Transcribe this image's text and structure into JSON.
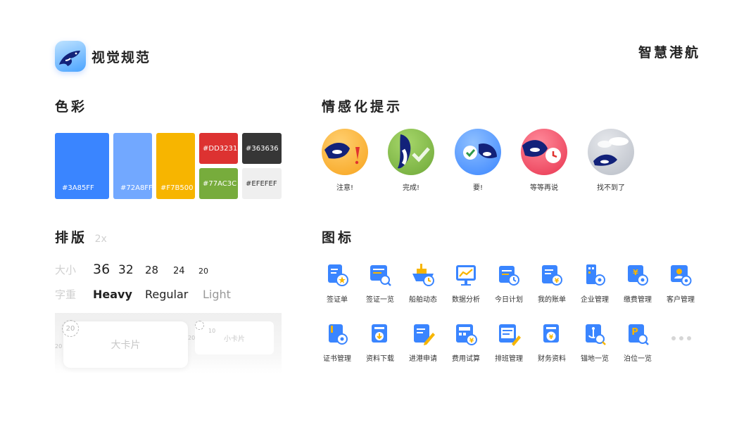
{
  "brand": {
    "title": "视觉规范"
  },
  "product_name": "智慧港航",
  "sections": {
    "colors": "色彩",
    "emotional": "情感化提示",
    "typography": "排版",
    "typography_scale": "2x",
    "icons": "图标"
  },
  "colors": [
    {
      "hex": "#3A85FF",
      "label": "#3A85FF"
    },
    {
      "hex": "#72A8FF",
      "label": "#72A8FF"
    },
    {
      "hex": "#F7B500",
      "label": "#F7B500"
    },
    {
      "hex": "#DD3231",
      "label": "#DD3231"
    },
    {
      "hex": "#363636",
      "label": "#363636"
    },
    {
      "hex": "#77AC3C",
      "label": "#77AC3C"
    },
    {
      "hex": "#EFEFEF",
      "label": "#EFEFEF"
    }
  ],
  "emotions": [
    {
      "label": "注意!",
      "color": "#F7B500",
      "icon": "warning-orca-icon"
    },
    {
      "label": "完成!",
      "color": "#77AC3C",
      "icon": "success-orca-icon"
    },
    {
      "label": "要!",
      "color": "#3A85FF",
      "icon": "ok-orca-icon"
    },
    {
      "label": "等等再说",
      "color": "#DD3231",
      "icon": "clock-orca-icon"
    },
    {
      "label": "找不到了",
      "color": "#C9CDD3",
      "icon": "not-found-orca-icon"
    }
  ],
  "typography": {
    "size_label": "大小",
    "sizes": [
      "36",
      "32",
      "28",
      "24",
      "20"
    ],
    "weight_label": "字重",
    "weights": [
      "Heavy",
      "Regular",
      "Light"
    ],
    "big_card": "大卡片",
    "small_card": "小卡片",
    "big_radius": "20",
    "small_radius": "10",
    "gap_left": "20",
    "gap_mid": "20"
  },
  "icons_row1": [
    {
      "label": "签证单",
      "icon": "visa-form-icon"
    },
    {
      "label": "签证一览",
      "icon": "visa-list-icon"
    },
    {
      "label": "船舶动态",
      "icon": "ship-status-icon"
    },
    {
      "label": "数据分析",
      "icon": "data-analysis-icon"
    },
    {
      "label": "今日计划",
      "icon": "today-plan-icon"
    },
    {
      "label": "我的账单",
      "icon": "my-bill-icon"
    },
    {
      "label": "企业管理",
      "icon": "company-manage-icon"
    },
    {
      "label": "缴费管理",
      "icon": "payment-manage-icon"
    },
    {
      "label": "客户管理",
      "icon": "customer-manage-icon"
    }
  ],
  "icons_row2": [
    {
      "label": "证书管理",
      "icon": "certificate-manage-icon"
    },
    {
      "label": "资料下载",
      "icon": "download-icon"
    },
    {
      "label": "进港申请",
      "icon": "port-apply-icon"
    },
    {
      "label": "费用试算",
      "icon": "fee-calc-icon"
    },
    {
      "label": "排班管理",
      "icon": "schedule-icon"
    },
    {
      "label": "财务资料",
      "icon": "finance-icon"
    },
    {
      "label": "锚地一览",
      "icon": "anchorage-icon"
    },
    {
      "label": "泊位一览",
      "icon": "berth-icon"
    }
  ],
  "accent": "#3A85FF",
  "accent_secondary": "#F7B500"
}
